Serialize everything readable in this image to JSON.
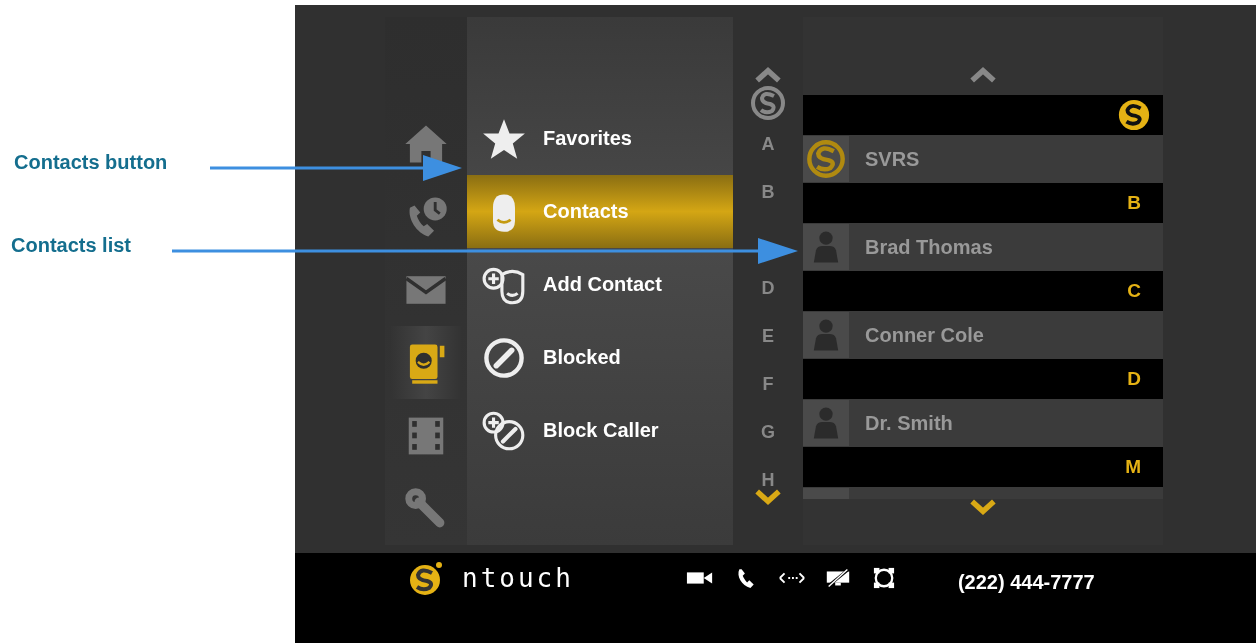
{
  "callouts": [
    {
      "label": "Contacts button"
    },
    {
      "label": "Contacts list"
    }
  ],
  "nav_rail": [
    {
      "kind": "home",
      "selected": false
    },
    {
      "kind": "recent-calls",
      "selected": false
    },
    {
      "kind": "mail",
      "selected": false
    },
    {
      "kind": "contacts",
      "selected": true
    },
    {
      "kind": "video",
      "selected": false
    },
    {
      "kind": "settings",
      "selected": false
    }
  ],
  "menu": [
    {
      "label": "Favorites",
      "kind": "star",
      "selected": false
    },
    {
      "label": "Contacts",
      "kind": "contact",
      "selected": true
    },
    {
      "label": "Add Contact",
      "kind": "add-contact",
      "selected": false
    },
    {
      "label": "Blocked",
      "kind": "blocked",
      "selected": false
    },
    {
      "label": "Block Caller",
      "kind": "block-caller",
      "selected": false
    }
  ],
  "alphabet_index": [
    {
      "kind": "letter",
      "letter": "A"
    },
    {
      "kind": "letter",
      "letter": "B"
    },
    {
      "kind": "covered"
    },
    {
      "kind": "letter",
      "letter": "D"
    },
    {
      "kind": "letter",
      "letter": "E"
    },
    {
      "kind": "letter",
      "letter": "F"
    },
    {
      "kind": "letter",
      "letter": "G"
    },
    {
      "kind": "letter",
      "letter": "H"
    }
  ],
  "contact_list": [
    {
      "kind": "logo",
      "contacts": [
        {
          "name": "SVRS",
          "kind": "logo"
        }
      ]
    },
    {
      "header": "B",
      "kind": "letter",
      "contacts": [
        {
          "name": "Brad Thomas",
          "kind": "person"
        }
      ]
    },
    {
      "header": "C",
      "kind": "letter",
      "contacts": [
        {
          "name": "Conner Cole",
          "kind": "person"
        }
      ]
    },
    {
      "header": "D",
      "kind": "letter",
      "contacts": [
        {
          "name": "Dr. Smith",
          "kind": "person"
        }
      ]
    },
    {
      "header": "M",
      "kind": "letter"
    }
  ],
  "status_bar": {
    "brand": "ntouch",
    "phone": "(222) 444-7777"
  }
}
